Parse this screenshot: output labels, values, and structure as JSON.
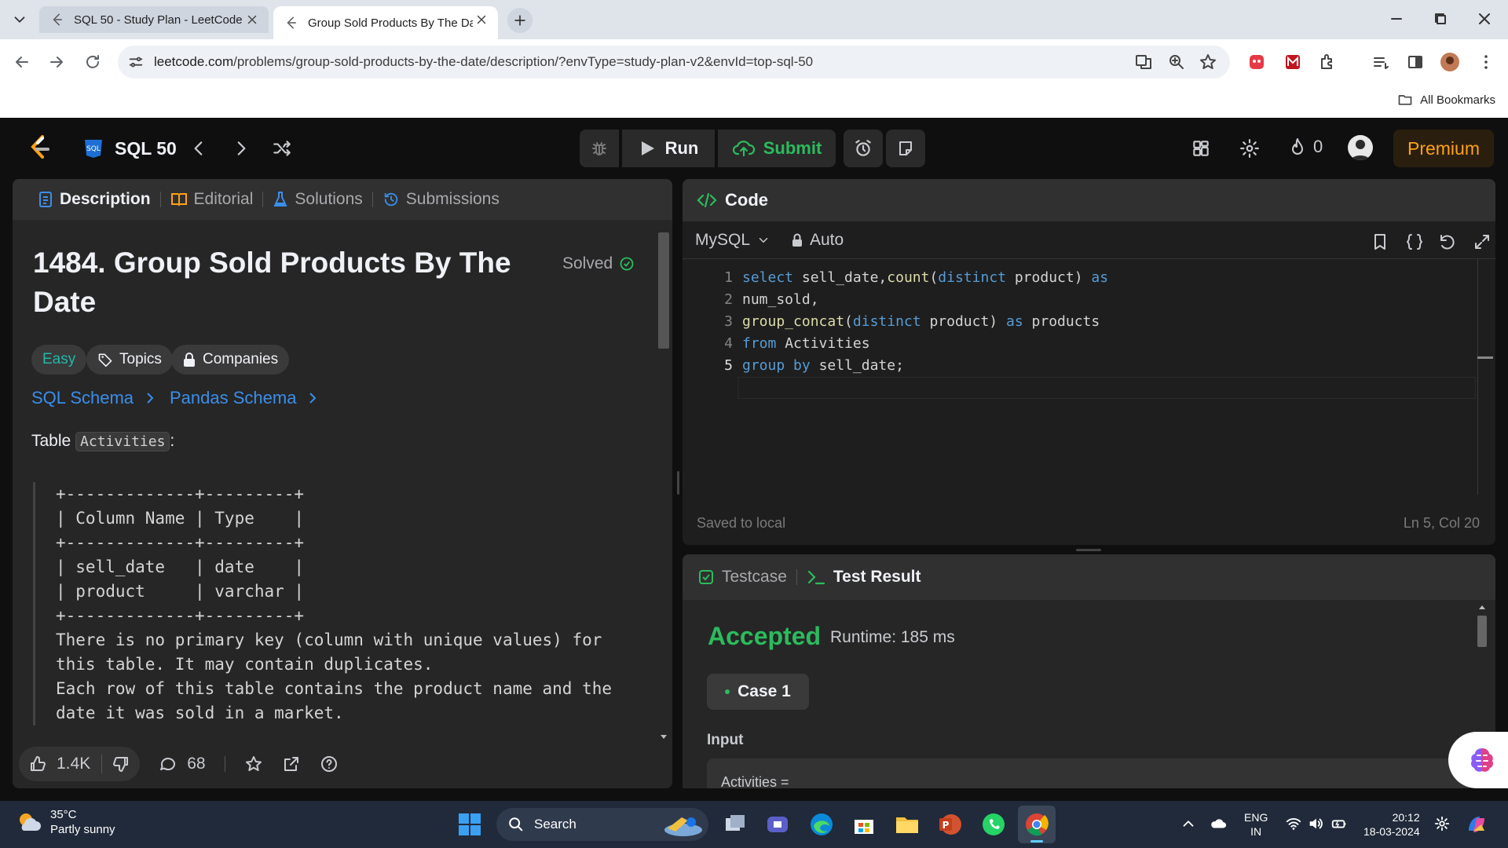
{
  "browser": {
    "tabs": [
      {
        "title": "SQL 50 - Study Plan - LeetCode"
      },
      {
        "title": "Group Sold Products By The Da"
      }
    ],
    "url_host": "leetcode.com",
    "url_path": "/problems/group-sold-products-by-the-date/description/?envType=study-plan-v2&envId=top-sql-50",
    "bookmarks_label": "All Bookmarks"
  },
  "lc_nav": {
    "study_plan": "SQL 50",
    "run_label": "Run",
    "submit_label": "Submit",
    "streak_count": "0",
    "premium_label": "Premium"
  },
  "description_panel": {
    "tabs": [
      "Description",
      "Editorial",
      "Solutions",
      "Submissions"
    ],
    "title": "1484. Group Sold Products By The Date",
    "status": "Solved",
    "difficulty": "Easy",
    "topics_label": "Topics",
    "companies_label": "Companies",
    "schema_links": [
      "SQL Schema",
      "Pandas Schema"
    ],
    "table_intro_prefix": "Table ",
    "table_name": "Activities",
    "table_intro_suffix": ":",
    "schema_text": "+-------------+---------+\n| Column Name | Type    |\n+-------------+---------+\n| sell_date   | date    |\n| product     | varchar |\n+-------------+---------+\nThere is no primary key (column with unique values) for\nthis table. It may contain duplicates.\nEach row of this table contains the product name and the\ndate it was sold in a market.",
    "likes": "1.4K",
    "comments": "68"
  },
  "code_panel": {
    "header": "Code",
    "language": "MySQL",
    "mode": "Auto",
    "line_numbers": [
      "1",
      "2",
      "3",
      "4",
      "5"
    ],
    "status": "Saved to local",
    "cursor": "Ln 5, Col 20"
  },
  "result_panel": {
    "tabs": [
      "Testcase",
      "Test Result"
    ],
    "verdict": "Accepted",
    "runtime": "Runtime: 185 ms",
    "case_label": "Case 1",
    "input_label": "Input",
    "input_value": "Activities ="
  },
  "taskbar": {
    "temperature": "35°C",
    "weather": "Partly sunny",
    "search_label": "Search",
    "lang_line1": "ENG",
    "lang_line2": "IN",
    "time": "20:12",
    "date": "18-03-2024"
  },
  "colors": {
    "accent_green": "#2cbb5d",
    "easy_teal": "#22b8aa",
    "premium_orange": "#ffa116",
    "link_blue": "#3b8eea"
  }
}
